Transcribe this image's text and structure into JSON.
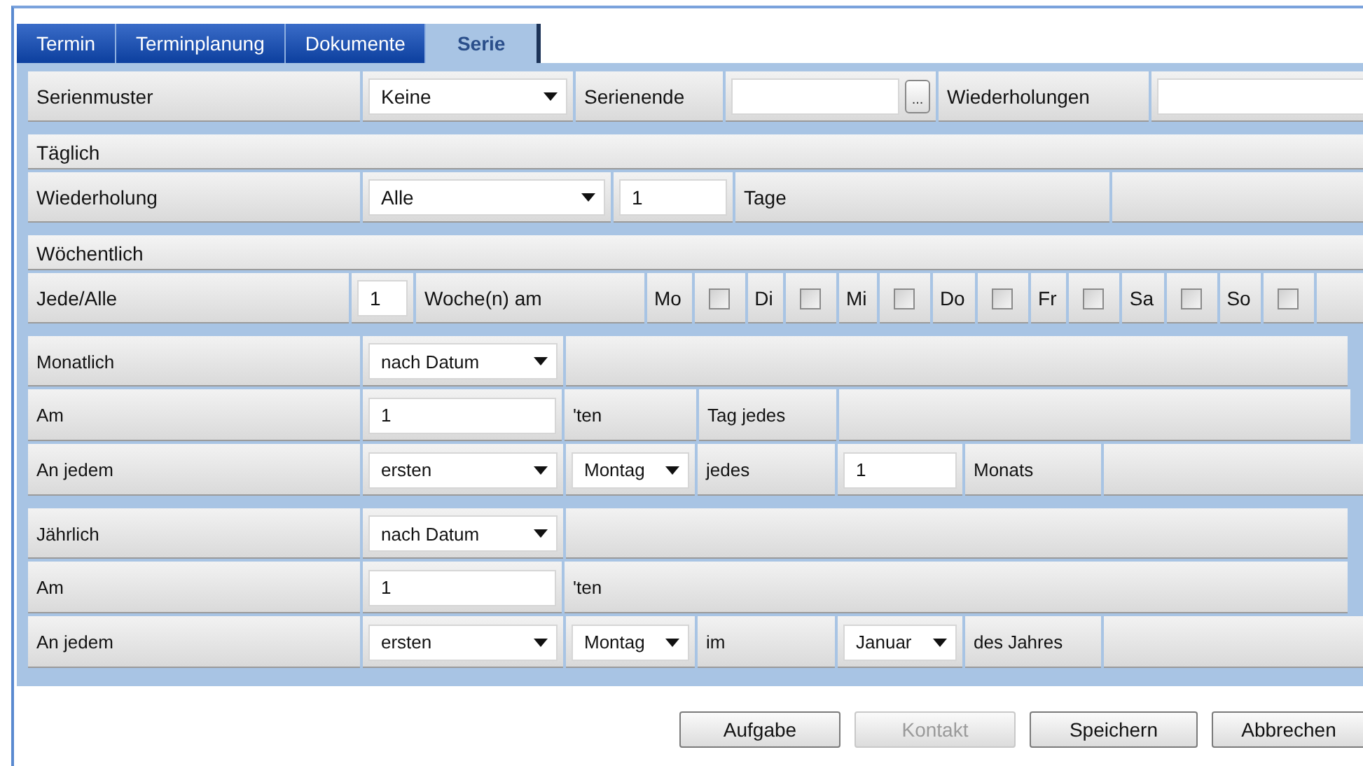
{
  "tabs": [
    {
      "label": "Termin",
      "selected": false
    },
    {
      "label": "Terminplanung",
      "selected": false
    },
    {
      "label": "Dokumente",
      "selected": false
    },
    {
      "label": "Serie",
      "selected": true
    }
  ],
  "serie": {
    "label": "Serienmuster",
    "pattern": "Keine",
    "end_label": "Serienende",
    "end_button": "...",
    "repeats_label": "Wiederholungen"
  },
  "daily": {
    "title": "Täglich",
    "label": "Wiederholung",
    "mode": "Alle",
    "count": "1",
    "unit": "Tage"
  },
  "weekly": {
    "title": "Wöchentlich",
    "label": "Jede/Alle",
    "count": "1",
    "unit": "Woche(n) am",
    "days": [
      {
        "label": "Mo",
        "checked": false
      },
      {
        "label": "Di",
        "checked": false
      },
      {
        "label": "Mi",
        "checked": false
      },
      {
        "label": "Do",
        "checked": false
      },
      {
        "label": "Fr",
        "checked": false
      },
      {
        "label": "Sa",
        "checked": false
      },
      {
        "label": "So",
        "checked": false
      }
    ]
  },
  "monthly": {
    "title": "Monatlich",
    "mode": "nach Datum",
    "day_label": "Am",
    "day": "1",
    "day_suffix": "'ten",
    "day_unit": "Tag jedes",
    "weekday_label": "An jedem",
    "ordinal": "ersten",
    "weekday": "Montag",
    "every_label": "jedes",
    "interval": "1",
    "interval_unit": "Monats"
  },
  "yearly": {
    "title": "Jährlich",
    "mode": "nach Datum",
    "day_label": "Am",
    "day": "1",
    "day_suffix": "'ten",
    "weekday_label": "An jedem",
    "ordinal": "ersten",
    "weekday": "Montag",
    "in_label": "im",
    "month": "Januar",
    "month_suffix": "des Jahres"
  },
  "buttons": [
    {
      "label": "Aufgabe",
      "disabled": false
    },
    {
      "label": "Kontakt",
      "disabled": true
    },
    {
      "label": "Speichern",
      "disabled": false
    },
    {
      "label": "Abbrechen",
      "disabled": false
    }
  ]
}
